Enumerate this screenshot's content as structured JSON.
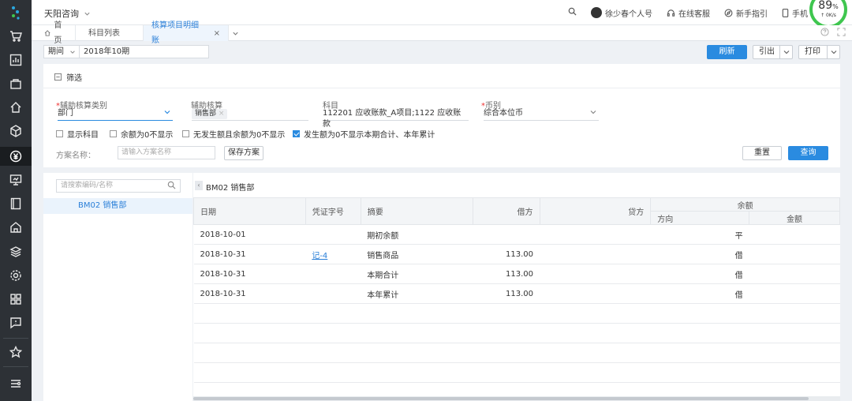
{
  "app": {
    "brand": "天阳咨询",
    "user": "徐少春个人号",
    "service": "在线客服",
    "guide": "新手指引",
    "mobile": "手机",
    "gauge_pct": "89",
    "gauge_unit": "%",
    "gauge_speed": "0K/s"
  },
  "tabs": [
    {
      "label": "首页"
    },
    {
      "label": "科目列表"
    },
    {
      "label": "核算项目明细账"
    }
  ],
  "period": {
    "label": "期间",
    "value": "2018年10期"
  },
  "toolbar": {
    "refresh": "刷新",
    "export": "引出",
    "print": "打印"
  },
  "filter": {
    "title": "筛选",
    "aux_type_label": "辅助核算类别",
    "aux_type_value": "部门",
    "aux_label": "辅助核算",
    "aux_tag": "销售部",
    "account_label": "科目",
    "account_value": "112201 应收账款_A项目;1122 应收账款",
    "currency_label": "币别",
    "currency_value": "综合本位币",
    "checks": [
      {
        "label": "显示科目",
        "checked": false
      },
      {
        "label": "余额为0不显示",
        "checked": false
      },
      {
        "label": "无发生额且余额为0不显示",
        "checked": false
      },
      {
        "label": "发生额为0不显示本期合计、本年累计",
        "checked": true
      }
    ],
    "plan_label": "方案名称：",
    "plan_placeholder": "请输入方案名称",
    "save_plan": "保存方案",
    "reset": "重置",
    "query": "查询"
  },
  "tree": {
    "search_placeholder": "请搜索编码/名称",
    "items": [
      {
        "label": "BM02 销售部"
      }
    ]
  },
  "grid": {
    "title": "BM02 销售部",
    "headers": {
      "date": "日期",
      "voucher": "凭证字号",
      "summary": "摘要",
      "debit": "借方",
      "credit": "贷方",
      "balance": "余额",
      "direction": "方向",
      "amount": "金额"
    },
    "rows": [
      {
        "date": "2018-10-01",
        "voucher": "",
        "summary": "期初余额",
        "debit": "",
        "credit": "",
        "direction": "平",
        "amount": ""
      },
      {
        "date": "2018-10-31",
        "voucher": "记-4",
        "summary": "销售商品",
        "debit": "113.00",
        "credit": "",
        "direction": "借",
        "amount": ""
      },
      {
        "date": "2018-10-31",
        "voucher": "",
        "summary": "本期合计",
        "debit": "113.00",
        "credit": "",
        "direction": "借",
        "amount": ""
      },
      {
        "date": "2018-10-31",
        "voucher": "",
        "summary": "本年累计",
        "debit": "113.00",
        "credit": "",
        "direction": "借",
        "amount": ""
      }
    ]
  }
}
